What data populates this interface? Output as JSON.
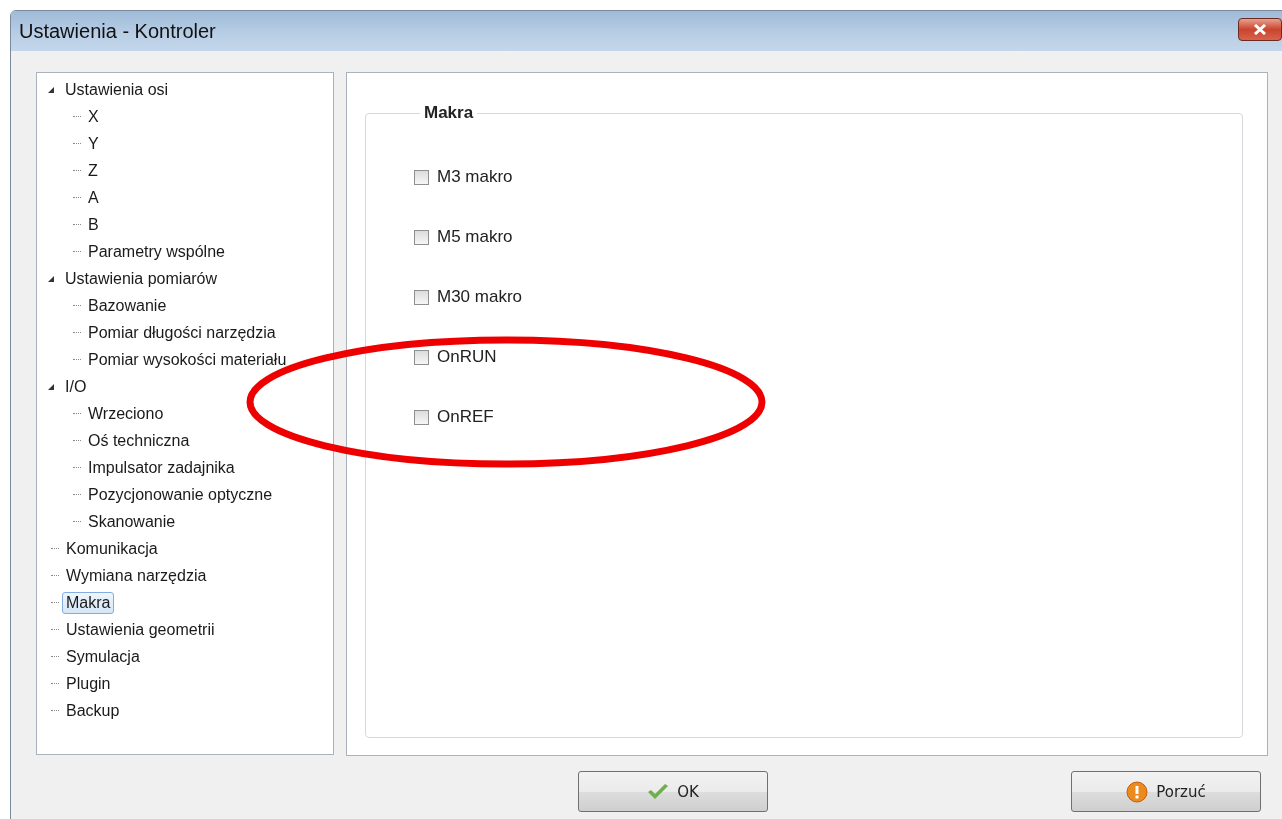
{
  "window": {
    "title": "Ustawienia - Kontroler"
  },
  "tree": [
    {
      "label": "Ustawienia osi",
      "expanded": true,
      "selected": false,
      "children": [
        {
          "label": "X",
          "selected": false
        },
        {
          "label": "Y",
          "selected": false
        },
        {
          "label": "Z",
          "selected": false
        },
        {
          "label": "A",
          "selected": false
        },
        {
          "label": "B",
          "selected": false
        },
        {
          "label": "Parametry wspólne",
          "selected": false
        }
      ]
    },
    {
      "label": "Ustawienia pomiarów",
      "expanded": true,
      "selected": false,
      "children": [
        {
          "label": "Bazowanie",
          "selected": false
        },
        {
          "label": "Pomiar długości narzędzia",
          "selected": false
        },
        {
          "label": "Pomiar wysokości materiału",
          "selected": false
        }
      ]
    },
    {
      "label": "I/O",
      "expanded": true,
      "selected": false,
      "children": [
        {
          "label": "Wrzeciono",
          "selected": false
        },
        {
          "label": "Oś techniczna",
          "selected": false
        },
        {
          "label": "Impulsator zadajnika",
          "selected": false
        },
        {
          "label": "Pozycjonowanie optyczne",
          "selected": false
        },
        {
          "label": "Skanowanie",
          "selected": false
        }
      ]
    },
    {
      "label": "Komunikacja",
      "selected": false
    },
    {
      "label": "Wymiana narzędzia",
      "selected": false
    },
    {
      "label": "Makra",
      "selected": true
    },
    {
      "label": "Ustawienia geometrii",
      "selected": false
    },
    {
      "label": "Symulacja",
      "selected": false
    },
    {
      "label": "Plugin",
      "selected": false
    },
    {
      "label": "Backup",
      "selected": false
    }
  ],
  "group": {
    "title": "Makra",
    "options": [
      {
        "label": "M3 makro",
        "checked": false
      },
      {
        "label": "M5 makro",
        "checked": false
      },
      {
        "label": "M30 makro",
        "checked": false
      },
      {
        "label": "OnRUN",
        "checked": false
      },
      {
        "label": "OnREF",
        "checked": false
      }
    ]
  },
  "buttons": [
    {
      "label": "OK",
      "kind": "confirm"
    },
    {
      "label": "Porzuć",
      "kind": "cancel"
    }
  ]
}
